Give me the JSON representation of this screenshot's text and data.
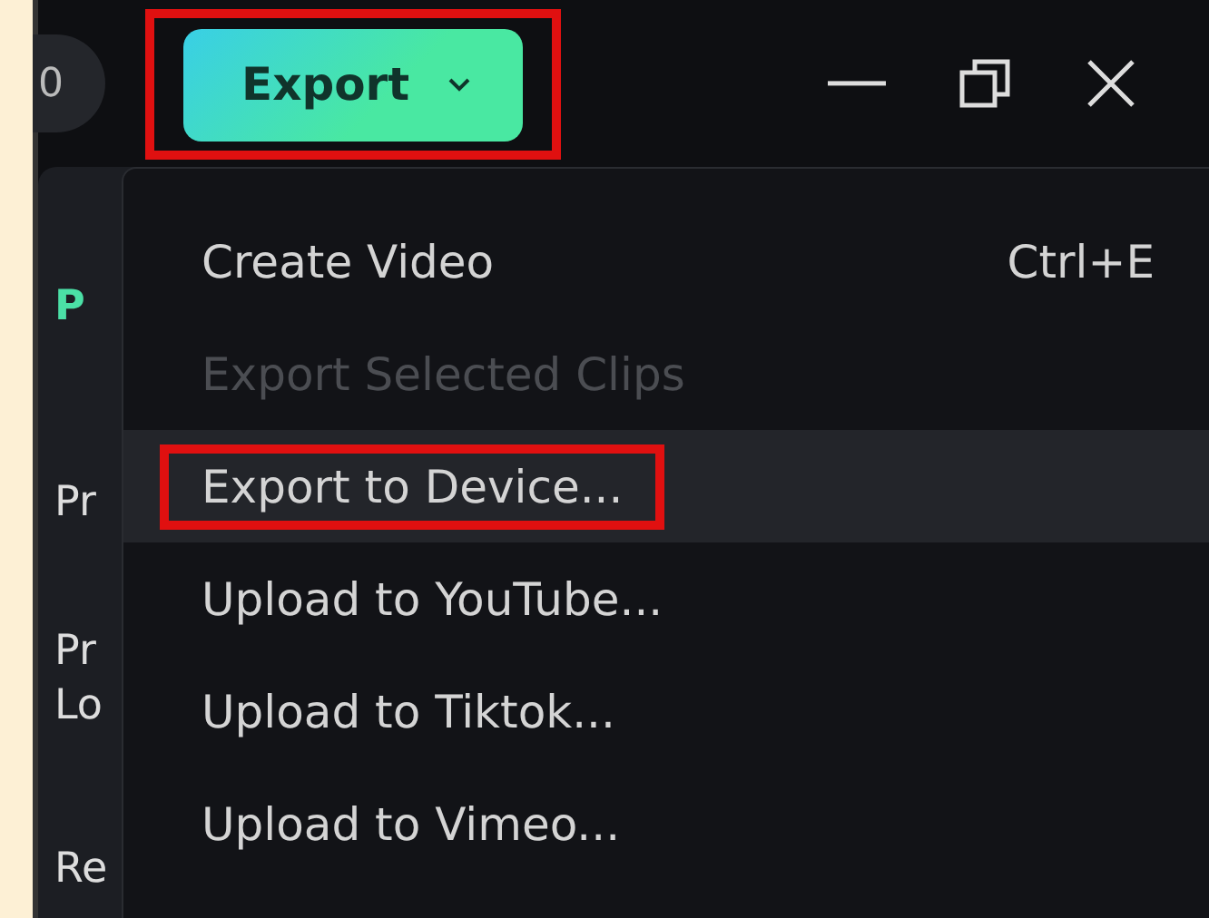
{
  "title_bar": {
    "badge": "0",
    "export_button": {
      "label": "Export",
      "annotated": true
    }
  },
  "side_panel": {
    "items": [
      {
        "text": "P",
        "kind": "accent"
      },
      {
        "text": "Pr",
        "kind": "plain"
      },
      {
        "text": "Pr",
        "kind": "plain"
      },
      {
        "text": "Lo",
        "kind": "plain"
      },
      {
        "text": "Re",
        "kind": "plain"
      }
    ]
  },
  "export_menu": {
    "items": [
      {
        "label": "Create Video",
        "shortcut": "Ctrl+E",
        "disabled": false,
        "selected": false,
        "annotated": false
      },
      {
        "label": "Export Selected Clips",
        "disabled": true,
        "selected": false,
        "annotated": false
      },
      {
        "label": "Export to Device...",
        "disabled": false,
        "selected": true,
        "annotated": true
      },
      {
        "label": "Upload to YouTube...",
        "disabled": false,
        "selected": false,
        "annotated": false
      },
      {
        "label": "Upload to Tiktok...",
        "disabled": false,
        "selected": false,
        "annotated": false
      },
      {
        "label": "Upload to Vimeo...",
        "disabled": false,
        "selected": false,
        "annotated": false
      }
    ]
  }
}
